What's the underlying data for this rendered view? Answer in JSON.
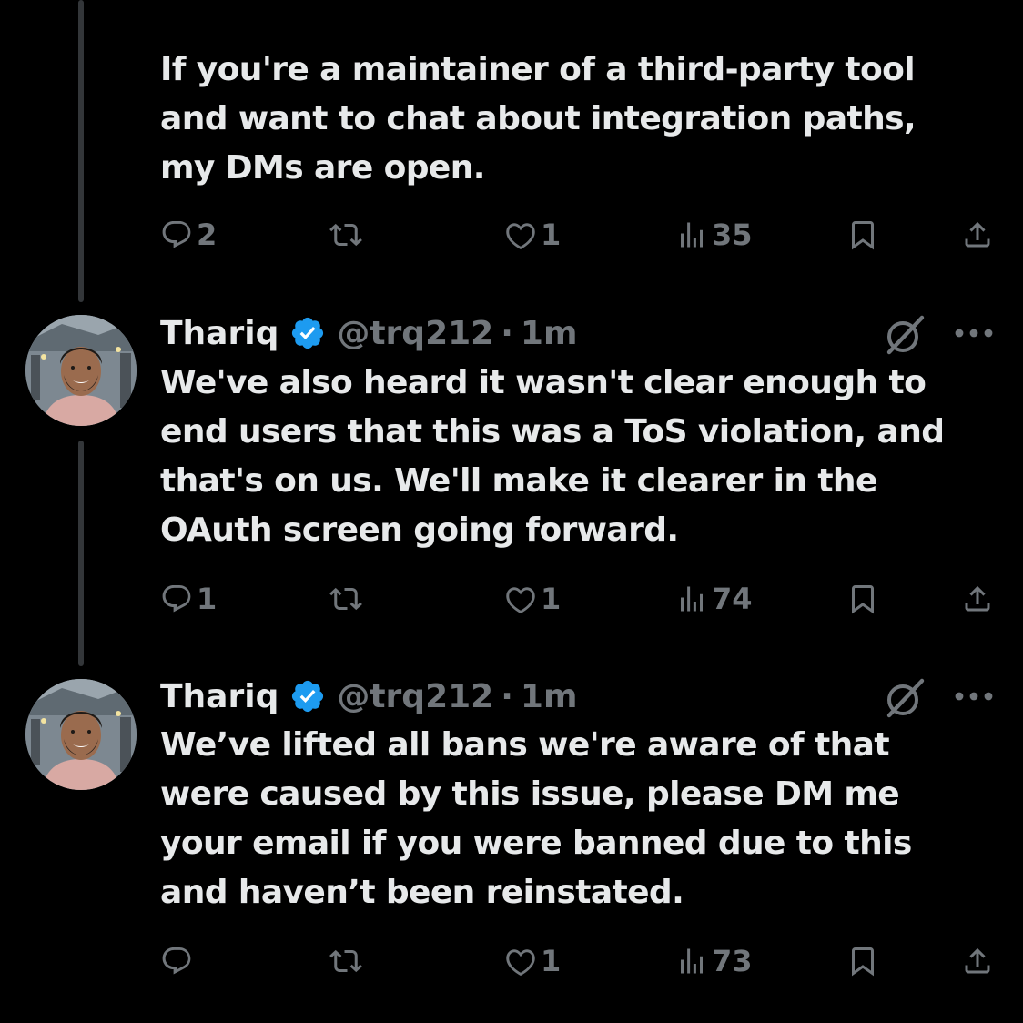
{
  "colors": {
    "background": "#000000",
    "text_primary": "#e7e9ea",
    "text_secondary": "#71767b",
    "verified_blue": "#1d9bf0",
    "thread_line": "#333639"
  },
  "tweets": [
    {
      "text": "If you're a maintainer of a third-party tool\nand want to chat about integration paths,\nmy DMs are open.",
      "actions": {
        "replies": "2",
        "reposts": "",
        "likes": "1",
        "views": "35"
      }
    },
    {
      "author": {
        "name": "Thariq",
        "handle": "@trq212",
        "time": "1m",
        "separator": "·",
        "verified": true
      },
      "text": "We've also heard it wasn't clear enough to\nend users that this was a ToS violation, and\nthat's on us. We'll make it clearer in the\nOAuth screen going forward.",
      "actions": {
        "replies": "1",
        "reposts": "",
        "likes": "1",
        "views": "74"
      }
    },
    {
      "author": {
        "name": "Thariq",
        "handle": "@trq212",
        "time": "1m",
        "separator": "·",
        "verified": true
      },
      "text": "We’ve lifted all bans we're aware of that\nwere caused by this issue, please DM me\nyour email if you were banned due to this\nand haven’t been reinstated.",
      "actions": {
        "replies": "",
        "reposts": "",
        "likes": "1",
        "views": "73"
      }
    }
  ],
  "icons": {
    "reply": "reply-icon",
    "repost": "repost-icon",
    "like": "heart-icon",
    "views": "views-icon",
    "bookmark": "bookmark-icon",
    "share": "share-icon",
    "grok": "grok-icon",
    "more": "more-icon",
    "verified": "verified-badge-icon"
  }
}
